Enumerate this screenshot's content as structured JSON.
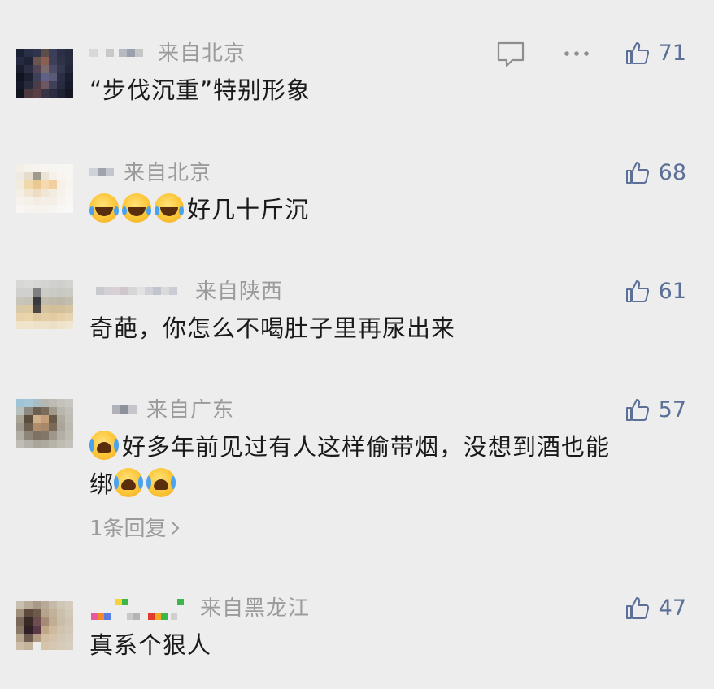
{
  "comments": [
    {
      "location": "来自北京",
      "text": "“步伐沉重”特别形象",
      "emojis_before": 0,
      "emojis_after": 0,
      "likes": "71",
      "show_actions": true,
      "reply_link": ""
    },
    {
      "location": "来自北京",
      "text": "好几十斤沉",
      "emojis_before": 3,
      "emojis_after": 0,
      "likes": "68",
      "show_actions": false,
      "reply_link": ""
    },
    {
      "location": "来自陕西",
      "text": "奇葩，你怎么不喝肚子里再尿出来",
      "emojis_before": 0,
      "emojis_after": 0,
      "likes": "61",
      "show_actions": false,
      "reply_link": ""
    },
    {
      "location": "来自广东",
      "text_line1": "好多年前见过有人这样偷带烟，没想到酒也能",
      "text_line2": "绑",
      "likes": "57",
      "show_actions": false,
      "reply_link": "1条回复"
    },
    {
      "location": "来自黑龙江",
      "text": "真系个狠人",
      "emojis_before": 0,
      "emojis_after": 0,
      "likes": "47",
      "show_actions": false,
      "reply_link": ""
    }
  ],
  "icons": {
    "like": "thumbs-up-icon",
    "comment": "comment-bubble-icon",
    "more": "more-dots-icon",
    "reply_chevron": "chevron-right-icon"
  },
  "colors": {
    "background": "#ededed",
    "text": "#1a1a1a",
    "meta": "#9b9b9b",
    "like": "#5b6f97"
  }
}
